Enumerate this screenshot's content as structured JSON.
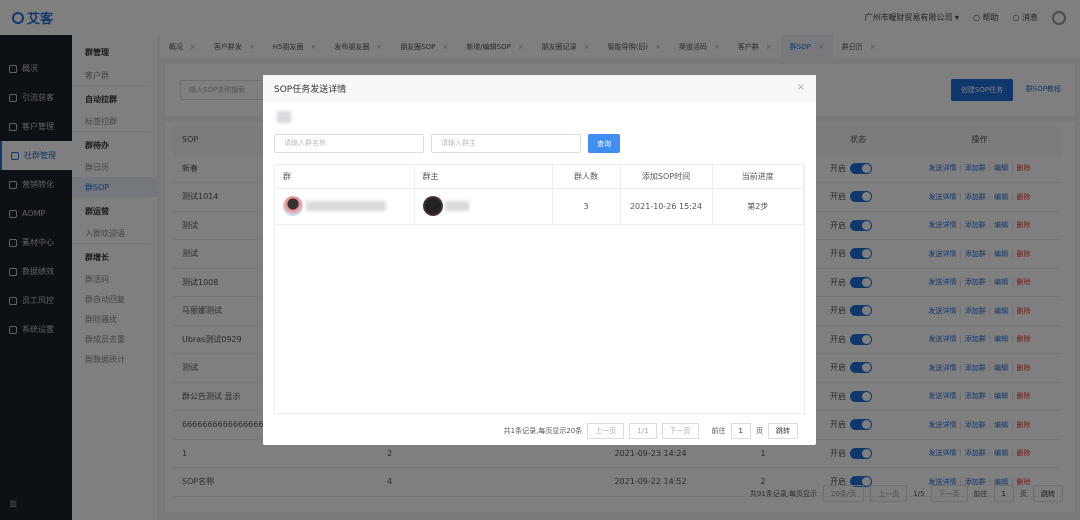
{
  "header": {
    "logo": "艾客",
    "company": "广州市喔财贸易有限公司 ▾",
    "help": "帮助",
    "notice": "消息",
    "gear_icon": "gear-icon"
  },
  "sidebar": {
    "items": [
      {
        "label": "概况"
      },
      {
        "label": "引流获客"
      },
      {
        "label": "客户管理"
      },
      {
        "label": "社群管理",
        "active": true
      },
      {
        "label": "营销转化"
      },
      {
        "label": "AOMP"
      },
      {
        "label": "素材中心"
      },
      {
        "label": "数据绩效"
      },
      {
        "label": "员工风控"
      },
      {
        "label": "系统设置"
      }
    ],
    "fold_icon": "≣"
  },
  "submenu": [
    {
      "group": "群管理",
      "items": [
        "客户群"
      ]
    },
    {
      "group": "自动拉群",
      "items": [
        "标签拉群"
      ]
    },
    {
      "group": "群待办",
      "items": [
        "群日历",
        "群SOP"
      ]
    },
    {
      "group": "群运营",
      "items": [
        "入群欢迎语"
      ]
    },
    {
      "group": "群增长",
      "items": [
        "群活码",
        "群自动回复",
        "群防骚扰",
        "群成员去重",
        "群数据统计"
      ]
    }
  ],
  "tabs": [
    "概况",
    "客户群发",
    "H5朋友圈",
    "发布朋友圈",
    "朋友圈SOP",
    "新增/编辑SOP",
    "朋友圈记录",
    "智能导购(旧)",
    "渠道活码",
    "客户群",
    "群SOP",
    "群日历"
  ],
  "toolbar": {
    "search_placeholder": "输入SOP名称搜索",
    "create": "创建SOP任务",
    "tutorial": "群SOP教程"
  },
  "table": {
    "headers": {
      "sop": "SOP",
      "status": "状态",
      "ops": "操作"
    },
    "status_label": "开启",
    "ops": [
      "发送详情",
      "添加群",
      "编辑",
      "删除"
    ],
    "rows": [
      {
        "name": "新春",
        "c2": "",
        "time": "",
        "c4": ""
      },
      {
        "name": "测试1014",
        "c2": "",
        "time": "",
        "c4": ""
      },
      {
        "name": "测试",
        "c2": "",
        "time": "",
        "c4": ""
      },
      {
        "name": "测试",
        "c2": "",
        "time": "",
        "c4": ""
      },
      {
        "name": "测试1008",
        "c2": "",
        "time": "",
        "c4": ""
      },
      {
        "name": "马丽娜测试",
        "c2": "",
        "time": "",
        "c4": ""
      },
      {
        "name": "Ubras测试0929",
        "c2": "",
        "time": "",
        "c4": ""
      },
      {
        "name": "测试",
        "c2": "",
        "time": "",
        "c4": ""
      },
      {
        "name": "群公告测试 显示",
        "c2": "",
        "time": "",
        "c4": ""
      },
      {
        "name": "6666666666666666",
        "c2": "",
        "time": "",
        "c4": ""
      },
      {
        "name": "1",
        "c2": "2",
        "time": "2021-09-23 14:24",
        "c4": "1"
      },
      {
        "name": "SOP名称",
        "c2": "4",
        "time": "2021-09-22 14:52",
        "c4": "2"
      }
    ]
  },
  "pagination": {
    "total": "共91条记录,每页显示",
    "page_size": "20条/页",
    "prev": "上一页",
    "page": "1/5",
    "next": "下一页",
    "goto": "前往",
    "goto_value": "1",
    "page_unit": "页",
    "jump": "跳转"
  },
  "modal": {
    "title": "SOP任务发送详情",
    "close": "×",
    "group_placeholder": "请输入群名称",
    "owner_placeholder": "请输入群主",
    "search": "查询",
    "headers": [
      "群",
      "群主",
      "群人数",
      "添加SOP时间",
      "当前进度"
    ],
    "rows": [
      {
        "members": "3",
        "time": "2021-10-26 15:24",
        "progress": "第2步"
      }
    ],
    "pagination": {
      "total": "共1条记录,每页显示20条",
      "prev": "上一页",
      "page": "1/1",
      "next": "下一页",
      "goto": "前往",
      "goto_value": "1",
      "page_unit": "页",
      "jump": "跳转"
    }
  },
  "colors": {
    "primary": "#1e6fd9",
    "sidebar": "#1b2028",
    "danger": "#e04040"
  }
}
